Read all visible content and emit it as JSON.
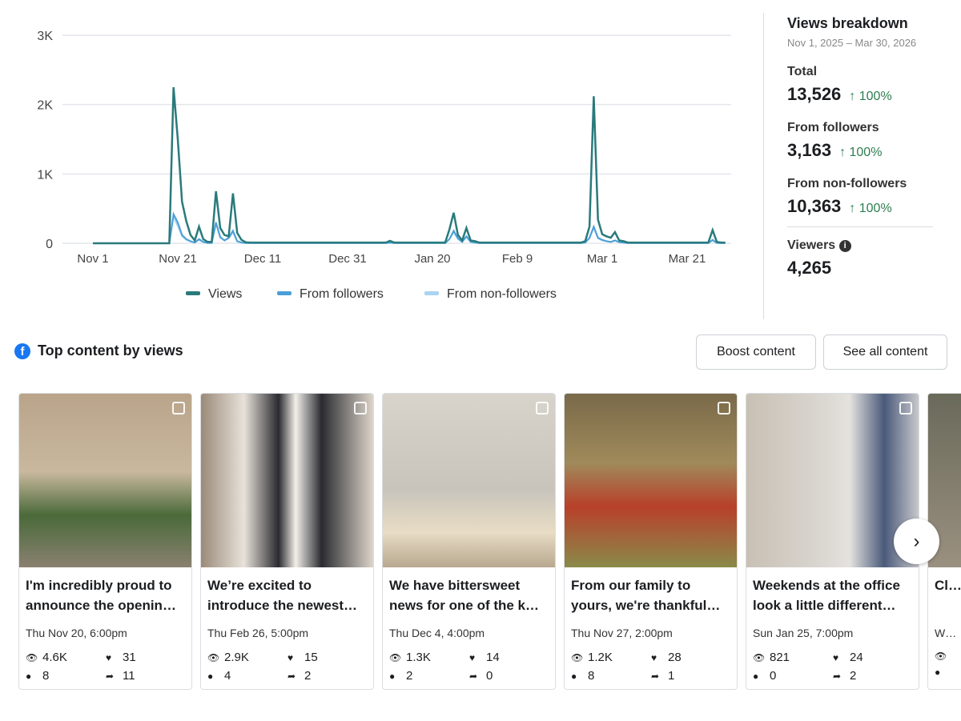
{
  "chart_data": {
    "type": "line",
    "x_tick_labels": [
      "Nov 1",
      "Nov 21",
      "Dec 11",
      "Dec 31",
      "Jan 20",
      "Feb 9",
      "Mar 1",
      "Mar 21"
    ],
    "y_tick_labels": [
      "0",
      "1K",
      "2K",
      "3K"
    ],
    "ylim": [
      0,
      3000
    ],
    "xlim": [
      "2025-11-01",
      "2026-03-30"
    ],
    "grid": true,
    "legend_position": "bottom",
    "colors": {
      "Views": "#2a7a7c",
      "From followers": "#4a9fd8",
      "From non-followers": "#a9d4f2"
    },
    "baseline_views": 10,
    "points": [
      [
        "2025-11-01",
        0,
        0,
        0
      ],
      [
        "2025-11-19",
        0,
        0,
        0
      ],
      [
        "2025-11-20",
        2250,
        420,
        380
      ],
      [
        "2025-11-21",
        1500,
        300,
        250
      ],
      [
        "2025-11-22",
        600,
        120,
        100
      ],
      [
        "2025-11-23",
        320,
        60,
        50
      ],
      [
        "2025-11-24",
        120,
        30,
        25
      ],
      [
        "2025-11-25",
        40,
        10,
        10
      ],
      [
        "2025-11-26",
        240,
        60,
        50
      ],
      [
        "2025-11-27",
        60,
        20,
        15
      ],
      [
        "2025-11-28",
        20,
        5,
        5
      ],
      [
        "2025-11-29",
        20,
        5,
        5
      ],
      [
        "2025-11-30",
        750,
        300,
        280
      ],
      [
        "2025-12-01",
        220,
        90,
        80
      ],
      [
        "2025-12-02",
        120,
        40,
        40
      ],
      [
        "2025-12-03",
        100,
        80,
        70
      ],
      [
        "2025-12-04",
        720,
        180,
        160
      ],
      [
        "2025-12-05",
        150,
        30,
        25
      ],
      [
        "2025-12-06",
        50,
        10,
        10
      ],
      [
        "2025-12-07",
        15,
        3,
        3
      ],
      [
        "2026-01-10",
        35,
        8,
        8
      ],
      [
        "2026-01-11",
        10,
        3,
        3
      ],
      [
        "2026-01-23",
        10,
        3,
        3
      ],
      [
        "2026-01-24",
        200,
        60,
        60
      ],
      [
        "2026-01-25",
        440,
        180,
        160
      ],
      [
        "2026-01-26",
        120,
        70,
        60
      ],
      [
        "2026-01-27",
        40,
        20,
        20
      ],
      [
        "2026-01-28",
        220,
        100,
        90
      ],
      [
        "2026-01-29",
        40,
        20,
        20
      ],
      [
        "2026-01-30",
        30,
        10,
        10
      ],
      [
        "2026-02-25",
        30,
        10,
        10
      ],
      [
        "2026-02-26",
        240,
        80,
        70
      ],
      [
        "2026-02-27",
        2120,
        240,
        220
      ],
      [
        "2026-02-28",
        340,
        80,
        70
      ],
      [
        "2026-03-01",
        130,
        50,
        40
      ],
      [
        "2026-03-02",
        100,
        30,
        30
      ],
      [
        "2026-03-03",
        80,
        20,
        20
      ],
      [
        "2026-03-04",
        160,
        40,
        40
      ],
      [
        "2026-03-05",
        40,
        15,
        15
      ],
      [
        "2026-03-06",
        30,
        10,
        10
      ],
      [
        "2026-03-26",
        10,
        3,
        3
      ],
      [
        "2026-03-27",
        190,
        50,
        40
      ],
      [
        "2026-03-28",
        20,
        5,
        5
      ],
      [
        "2026-03-30",
        10,
        3,
        3
      ]
    ],
    "series": [
      {
        "name": "Views"
      },
      {
        "name": "From followers"
      },
      {
        "name": "From non-followers"
      }
    ]
  },
  "breakdown": {
    "title": "Views breakdown",
    "range": "Nov 1, 2025 – Mar 30, 2026",
    "total_label": "Total",
    "total": "13,526",
    "total_change": "↑ 100%",
    "followers_label": "From followers",
    "followers": "3,163",
    "followers_change": "↑ 100%",
    "nonfollowers_label": "From non-followers",
    "nonfollowers": "10,363",
    "nonfollowers_change": "↑ 100%",
    "viewers_label": "Viewers",
    "viewers": "4,265"
  },
  "top": {
    "title": "Top content by views",
    "boost": "Boost content",
    "see_all": "See all content"
  },
  "cards": [
    {
      "title": "I'm incredibly proud to announce the openin…",
      "date": "Thu Nov 20, 6:00pm",
      "views": "4.6K",
      "reactions": "31",
      "comments": "8",
      "shares": "11",
      "bg": "linear-gradient(180deg,#b9a48a 0%,#c9b89e 45%,#4a6a3a 70%,#8a8070 100%)"
    },
    {
      "title": "We’re excited to introduce the newest…",
      "date": "Thu Feb 26, 5:00pm",
      "views": "2.9K",
      "reactions": "15",
      "comments": "4",
      "shares": "2",
      "bg": "linear-gradient(90deg,#9a8a78 0%,#e8e2da 25%,#2a2a30 45%,#f2efe9 55%,#2a2a30 70%,#ddd5ca 100%)"
    },
    {
      "title": "We have bittersweet news for one of the k…",
      "date": "Thu Dec 4, 4:00pm",
      "views": "1.3K",
      "reactions": "14",
      "comments": "2",
      "shares": "0",
      "bg": "linear-gradient(180deg,#d8d4cc 0%,#c8c4bc 55%,#e8dcc4 80%,#b8a890 100%)"
    },
    {
      "title": "From our family to yours, we're thankful…",
      "date": "Thu Nov 27, 2:00pm",
      "views": "1.2K",
      "reactions": "28",
      "comments": "8",
      "shares": "1",
      "bg": "linear-gradient(180deg,#7a6a4a 0%,#a08a5a 40%,#b8402a 65%,#8a8a4a 100%)"
    },
    {
      "title": "Weekends at the office look a little different…",
      "date": "Sun Jan 25, 7:00pm",
      "views": "821",
      "reactions": "24",
      "comments": "0",
      "shares": "2",
      "bg": "linear-gradient(90deg,#c8c0b4 0%,#d8d4ce 40%,#e4e2de 60%,#4a5a7a 80%,#c8c8cc 100%)"
    },
    {
      "title": "Cl… D…",
      "date": "W…",
      "views": "",
      "reactions": "",
      "comments": "",
      "shares": "",
      "bg": "linear-gradient(180deg,#6a6a5a,#9a9080)"
    }
  ]
}
